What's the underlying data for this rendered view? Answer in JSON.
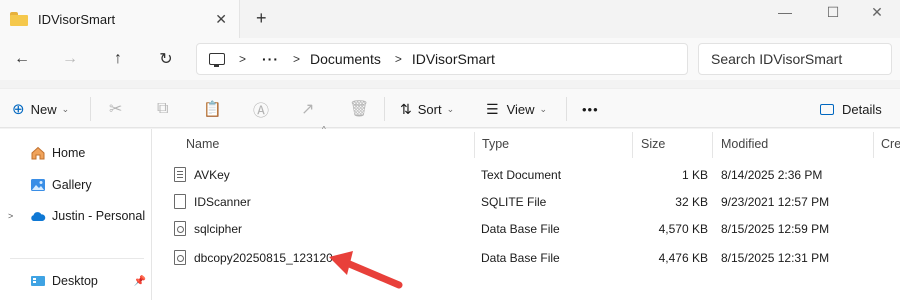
{
  "window": {
    "tab_title": "IDVisorSmart",
    "new_tab_glyph": "+",
    "close_tab_glyph": "✕",
    "minimize_glyph": "—",
    "maximize_glyph": "☐",
    "close_glyph": "✕"
  },
  "address": {
    "back_glyph": "←",
    "forward_glyph": "→",
    "up_glyph": "↑",
    "refresh_glyph": "↻",
    "more_glyph": "···",
    "breadcrumb": [
      "Documents",
      "IDVisorSmart"
    ],
    "separator_glyph": ">"
  },
  "search": {
    "placeholder": "Search IDVisorSmart"
  },
  "toolbar": {
    "new_label": "New",
    "sort_label": "Sort",
    "view_label": "View",
    "more_glyph": "•••",
    "details_label": "Details",
    "cut_glyph": "✂",
    "copy_glyph": "⧉",
    "paste_glyph": "📋",
    "rename_glyph": "Ⓐ",
    "share_glyph": "↗",
    "delete_glyph": "🗑"
  },
  "sidebar": {
    "items": [
      {
        "label": "Home",
        "icon": "home-icon"
      },
      {
        "label": "Gallery",
        "icon": "gallery-icon"
      },
      {
        "label": "Justin - Personal",
        "icon": "onedrive-cloud-icon"
      },
      {
        "label": "Desktop",
        "icon": "desktop-icon"
      }
    ]
  },
  "table": {
    "columns": [
      "Name",
      "Type",
      "Size",
      "Modified",
      "Cre"
    ],
    "rows": [
      {
        "name": "AVKey",
        "type": "Text Document",
        "size": "1 KB",
        "modified": "8/14/2025 2:36 PM",
        "icon": "text-document-icon"
      },
      {
        "name": "IDScanner",
        "type": "SQLITE File",
        "size": "32 KB",
        "modified": "9/23/2021 12:57 PM",
        "icon": "blank-file-icon"
      },
      {
        "name": "sqlcipher",
        "type": "Data Base File",
        "size": "4,570 KB",
        "modified": "8/15/2025 12:59 PM",
        "icon": "database-file-icon"
      },
      {
        "name": "dbcopy20250815_123120",
        "type": "Data Base File",
        "size": "4,476 KB",
        "modified": "8/15/2025 12:31 PM",
        "icon": "database-file-icon"
      }
    ]
  },
  "colors": {
    "accent": "#0067c0",
    "annotation_arrow": "#e8403a",
    "folder": "#f5c84c"
  }
}
